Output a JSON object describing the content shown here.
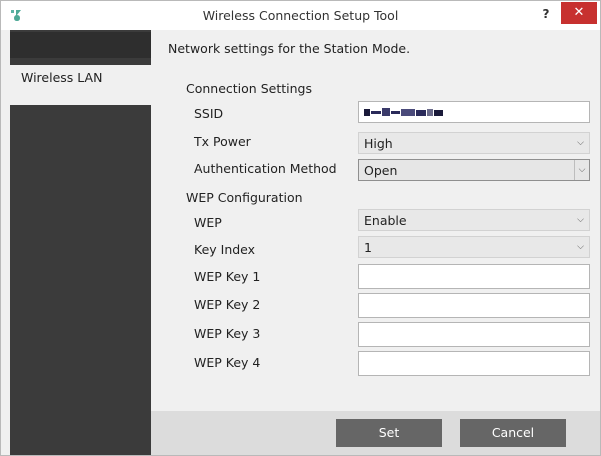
{
  "window": {
    "title": "Wireless Connection Setup Tool",
    "help_label": "?",
    "close_label": "✕"
  },
  "sidebar": {
    "items": [
      {
        "label": "Wireless LAN"
      }
    ]
  },
  "main": {
    "header": "Network settings for the Station Mode.",
    "connection": {
      "section_title": "Connection Settings",
      "ssid_label": "SSID",
      "tx_power_label": "Tx Power",
      "tx_power_value": "High",
      "auth_label": "Authentication Method",
      "auth_value": "Open"
    },
    "wep": {
      "section_title": "WEP Configuration",
      "wep_label": "WEP",
      "wep_value": "Enable",
      "key_index_label": "Key Index",
      "key_index_value": "1",
      "key1_label": "WEP Key 1",
      "key2_label": "WEP Key 2",
      "key3_label": "WEP Key 3",
      "key4_label": "WEP Key 4"
    }
  },
  "footer": {
    "set_label": "Set",
    "cancel_label": "Cancel"
  }
}
